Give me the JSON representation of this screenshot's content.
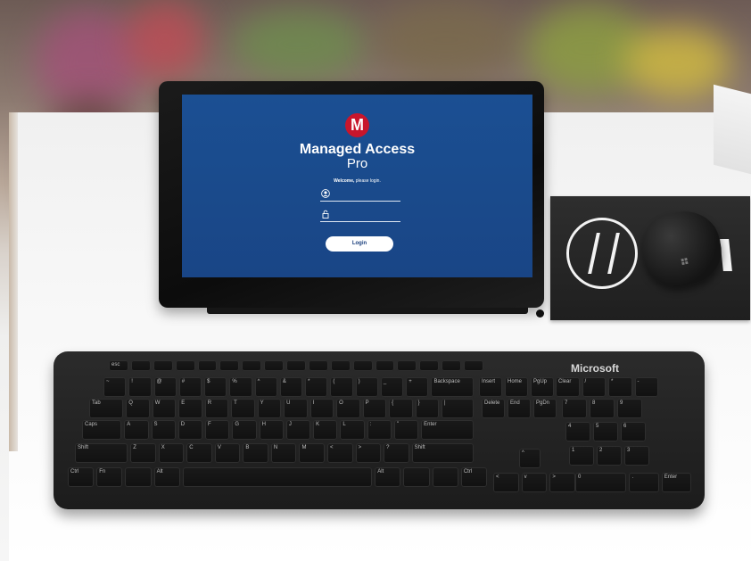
{
  "screen": {
    "logo_letter": "M",
    "title": "Managed Access",
    "subtitle": "Pro",
    "welcome_bold": "Welcome,",
    "welcome_rest": " please login.",
    "user_icon": "user-icon",
    "lock_icon": "lock-icon",
    "login_label": "Login"
  },
  "keyboard": {
    "brand": "Microsoft",
    "fn_row": [
      "esc",
      "",
      "",
      "",
      "",
      "",
      "",
      "",
      "",
      "",
      "",
      "",
      "",
      "",
      "",
      "",
      ""
    ],
    "row1": [
      "~",
      "!",
      "@",
      "#",
      "$",
      "%",
      "^",
      "&",
      "*",
      "(",
      ")",
      "_",
      "+",
      "Backspace"
    ],
    "row2": [
      "Tab",
      "Q",
      "W",
      "E",
      "R",
      "T",
      "Y",
      "U",
      "I",
      "O",
      "P",
      "{",
      "}",
      "|"
    ],
    "row3": [
      "Caps",
      "A",
      "S",
      "D",
      "F",
      "G",
      "H",
      "J",
      "K",
      "L",
      ":",
      "\"",
      "Enter"
    ],
    "row4": [
      "Shift",
      "Z",
      "X",
      "C",
      "V",
      "B",
      "N",
      "M",
      "<",
      ">",
      "?",
      "Shift"
    ],
    "row5": [
      "Ctrl",
      "Fn",
      "",
      "Alt",
      "",
      "Alt",
      "",
      "",
      "Ctrl"
    ],
    "nav1": [
      "Insert",
      "Home",
      "PgUp"
    ],
    "nav2": [
      "Delete",
      "End",
      "PgDn"
    ],
    "arrows": [
      "^",
      "<",
      "v",
      ">"
    ],
    "numpad1": [
      "Clear",
      "/",
      "*",
      "-"
    ],
    "numpad2": [
      "7",
      "8",
      "9"
    ],
    "numpad3": [
      "4",
      "5",
      "6"
    ],
    "numpad4": [
      "1",
      "2",
      "3"
    ],
    "numpad5": [
      "0",
      ".",
      "Enter"
    ]
  }
}
